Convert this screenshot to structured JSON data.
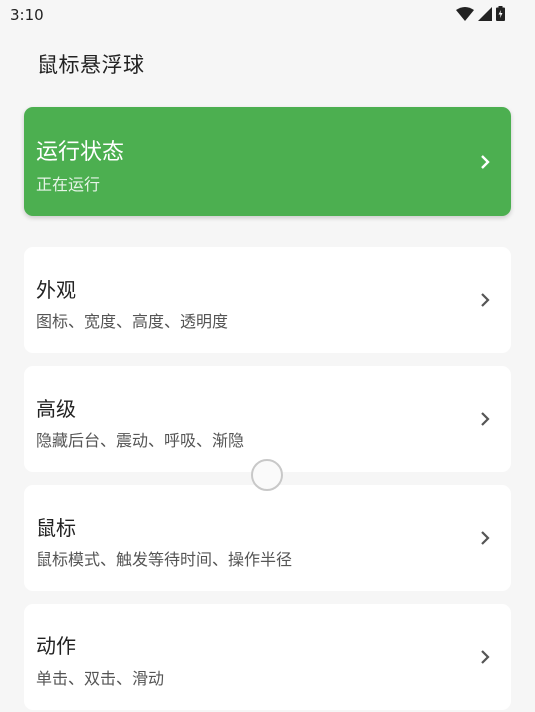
{
  "status_bar": {
    "time": "3:10",
    "icons": [
      "wifi-icon",
      "signal-icon",
      "battery-icon"
    ]
  },
  "header": {
    "title": "鼠标悬浮球"
  },
  "colors": {
    "accent": "#4caf50",
    "background": "#f6f6f6",
    "card": "#ffffff"
  },
  "cards": [
    {
      "title": "运行状态",
      "subtitle": "正在运行"
    },
    {
      "title": "外观",
      "subtitle": "图标、宽度、高度、透明度"
    },
    {
      "title": "高级",
      "subtitle": "隐藏后台、震动、呼吸、渐隐"
    },
    {
      "title": "鼠标",
      "subtitle": "鼠标模式、触发等待时间、操作半径"
    },
    {
      "title": "动作",
      "subtitle": "单击、双击、滑动"
    }
  ]
}
